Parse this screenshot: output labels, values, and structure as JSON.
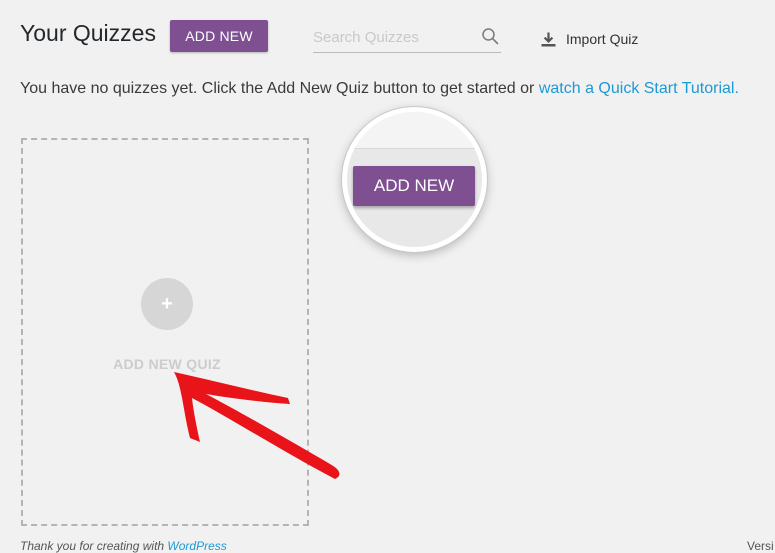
{
  "header": {
    "title": "Your Quizzes",
    "add_new_label": "ADD NEW",
    "search_placeholder": "Search Quizzes",
    "search_value": "",
    "import_label": "Import Quiz"
  },
  "intro": {
    "text": "You have no quizzes yet. Click the Add New Quiz button to get started or ",
    "link_text": "watch a Quick Start Tutorial."
  },
  "card": {
    "plus_symbol": "+",
    "label": "ADD NEW QUIZ"
  },
  "callout": {
    "button_label": "ADD NEW"
  },
  "footer": {
    "left_text": "Thank you for creating with ",
    "left_link": "WordPress",
    "right_text": "Versi"
  },
  "colors": {
    "accent_purple": "#7e5092",
    "link_blue": "#1b9ad6",
    "arrow_red": "#e8141a",
    "background": "#f1f1f1"
  },
  "icons": {
    "search": "search-icon",
    "import": "download-icon",
    "plus": "plus-icon",
    "annotation": "red-arrow-icon"
  }
}
